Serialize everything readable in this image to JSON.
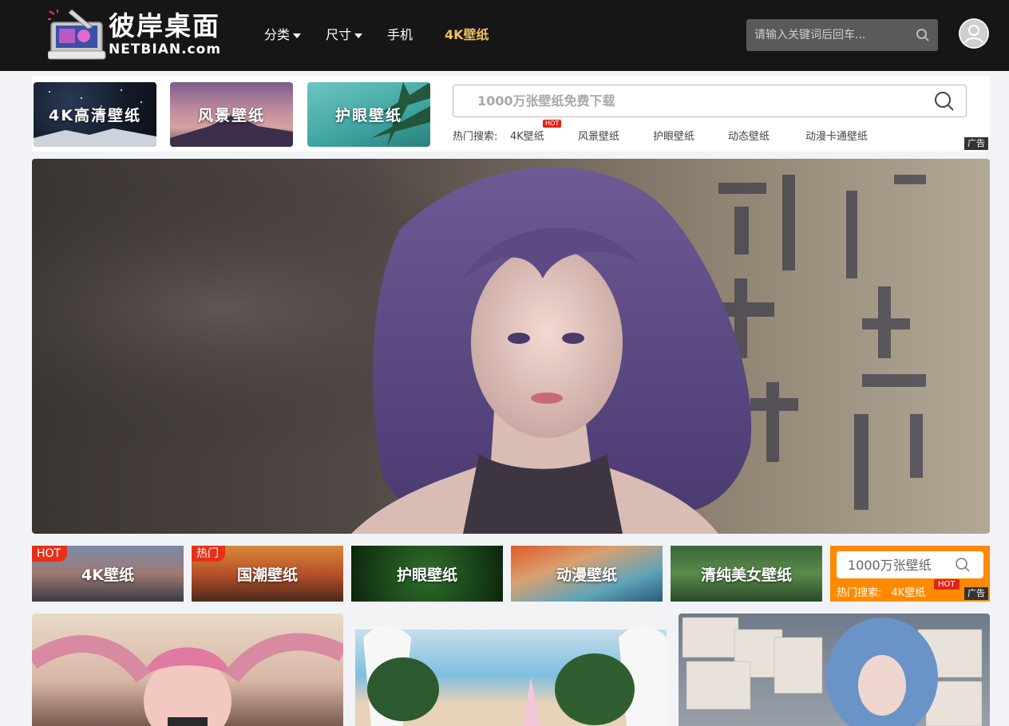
{
  "header": {
    "logo_text": "彼岸桌面",
    "logo_sub": "NETBIAN.com",
    "nav": [
      {
        "label": "分类",
        "dropdown": true
      },
      {
        "label": "尺寸",
        "dropdown": true
      },
      {
        "label": "手机",
        "dropdown": false
      },
      {
        "label": "4K壁纸",
        "dropdown": false,
        "active": true
      }
    ],
    "search_placeholder": "请输入关键词后回车...",
    "accent_color": "#f0c060"
  },
  "promo": {
    "tiles": [
      "4K高清壁纸",
      "风景壁纸",
      "护眼壁纸"
    ],
    "search_placeholder": "1000万张壁纸免费下载",
    "hot_label": "热门搜索:",
    "hot_terms": [
      "4K壁纸",
      "风景壁纸",
      "护眼壁纸",
      "动态壁纸",
      "动漫卡通壁纸"
    ],
    "hot_badge": "HOT",
    "ad_label": "广告"
  },
  "categories": [
    {
      "label": "4K壁纸",
      "badge": "HOT"
    },
    {
      "label": "国潮壁纸",
      "badge": "热门"
    },
    {
      "label": "护眼壁纸",
      "badge": ""
    },
    {
      "label": "动漫壁纸",
      "badge": ""
    },
    {
      "label": "清纯美女壁纸",
      "badge": ""
    }
  ],
  "cat_search": {
    "placeholder": "1000万张壁纸",
    "hot_label": "热门搜索:",
    "hot_term": "4K壁纸",
    "hot_badge": "HOT",
    "ad_label": "广告",
    "color": "#ff8a00"
  }
}
